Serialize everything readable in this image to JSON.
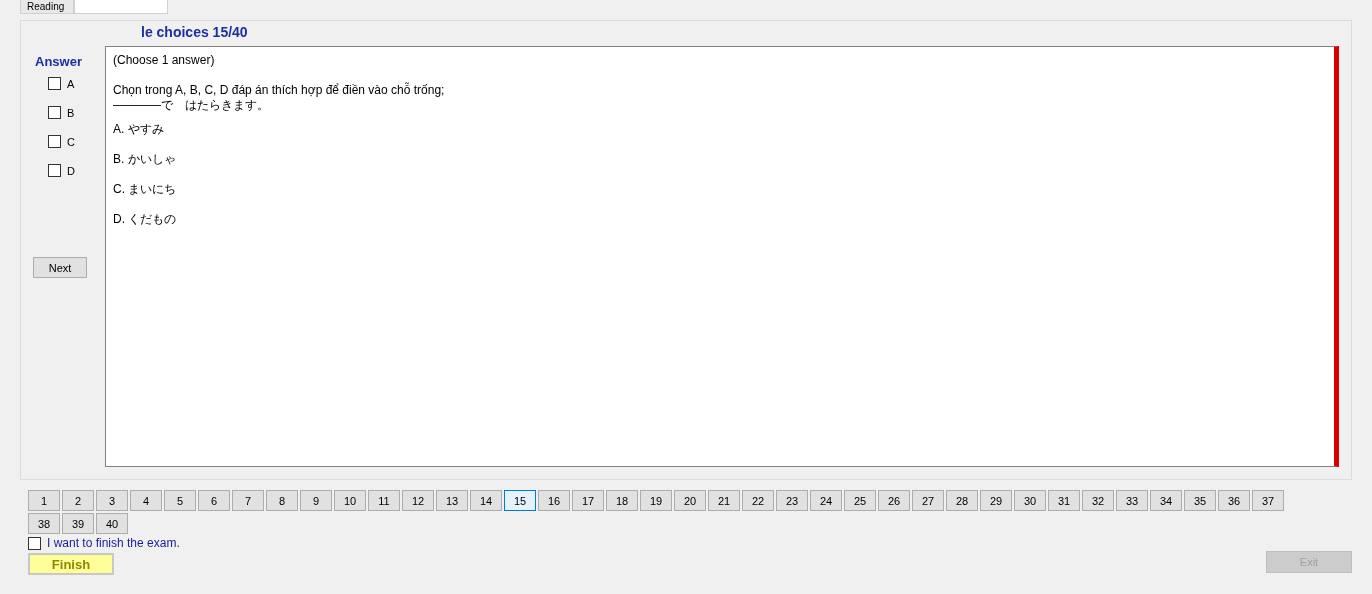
{
  "tabs": [
    {
      "label": "Reading",
      "selected": false
    },
    {
      "selected": true
    }
  ],
  "title": "le choices 15/40",
  "answer_panel": {
    "heading": "Answer",
    "options": [
      {
        "label": "A",
        "checked": false
      },
      {
        "label": "B",
        "checked": false
      },
      {
        "label": "C",
        "checked": false
      },
      {
        "label": "D",
        "checked": false
      }
    ],
    "next_button": "Next"
  },
  "question": {
    "instruction": "(Choose 1 answer)",
    "prompt": "Chọn trong A, B, C, D đáp án thích hợp để điền vào chỗ trống;",
    "sentence": "————で　はたらきます。",
    "choices": [
      "A.  やすみ",
      "B.  かいしゃ",
      "C.  まいにち",
      "D.  くだもの"
    ]
  },
  "question_nav": [
    {
      "label": "1",
      "selected": false
    },
    {
      "label": "2",
      "selected": false
    },
    {
      "label": "3",
      "selected": false
    },
    {
      "label": "4",
      "selected": false
    },
    {
      "label": "5",
      "selected": false
    },
    {
      "label": "6",
      "selected": false
    },
    {
      "label": "7",
      "selected": false
    },
    {
      "label": "8",
      "selected": false
    },
    {
      "label": "9",
      "selected": false
    },
    {
      "label": "10",
      "selected": false
    },
    {
      "label": "11",
      "selected": false
    },
    {
      "label": "12",
      "selected": false
    },
    {
      "label": "13",
      "selected": false
    },
    {
      "label": "14",
      "selected": false
    },
    {
      "label": "15",
      "selected": true
    },
    {
      "label": "16",
      "selected": false
    },
    {
      "label": "17",
      "selected": false
    },
    {
      "label": "18",
      "selected": false
    },
    {
      "label": "19",
      "selected": false
    },
    {
      "label": "20",
      "selected": false
    },
    {
      "label": "21",
      "selected": false
    },
    {
      "label": "22",
      "selected": false
    },
    {
      "label": "23",
      "selected": false
    },
    {
      "label": "24",
      "selected": false
    },
    {
      "label": "25",
      "selected": false
    },
    {
      "label": "26",
      "selected": false
    },
    {
      "label": "27",
      "selected": false
    },
    {
      "label": "28",
      "selected": false
    },
    {
      "label": "29",
      "selected": false
    },
    {
      "label": "30",
      "selected": false
    },
    {
      "label": "31",
      "selected": false
    },
    {
      "label": "32",
      "selected": false
    },
    {
      "label": "33",
      "selected": false
    },
    {
      "label": "34",
      "selected": false
    },
    {
      "label": "35",
      "selected": false
    },
    {
      "label": "36",
      "selected": false
    },
    {
      "label": "37",
      "selected": false
    },
    {
      "label": "38",
      "selected": false
    },
    {
      "label": "39",
      "selected": false
    },
    {
      "label": "40",
      "selected": false
    }
  ],
  "finish_confirm": {
    "label": "I want to finish the exam.",
    "checked": false
  },
  "finish_button": "Finish",
  "exit_button": {
    "label": "Exit",
    "disabled": true
  }
}
